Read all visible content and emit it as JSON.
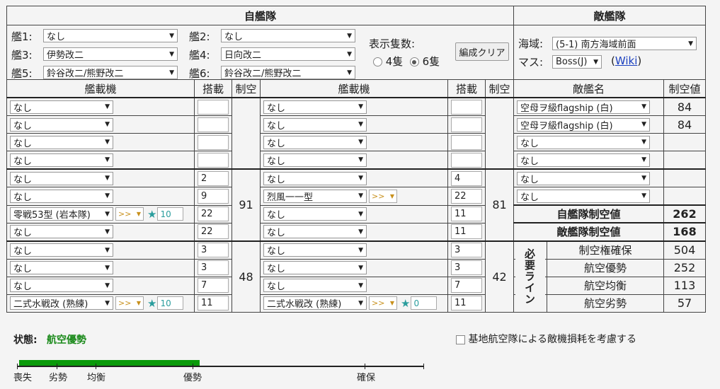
{
  "own_fleet": {
    "title": "自艦隊",
    "ships": [
      {
        "label": "艦1:",
        "value": "なし"
      },
      {
        "label": "艦2:",
        "value": "なし"
      },
      {
        "label": "艦3:",
        "value": "伊勢改二"
      },
      {
        "label": "艦4:",
        "value": "日向改二"
      },
      {
        "label": "艦5:",
        "value": "鈴谷改二/熊野改二"
      },
      {
        "label": "艦6:",
        "value": "鈴谷改二/熊野改二"
      }
    ],
    "display_count_label": "表示隻数:",
    "option_4": "4隻",
    "option_6": "6隻",
    "selected_option": "6隻",
    "clear_button": "編成クリア",
    "col_headers": {
      "aircraft": "艦載機",
      "slots": "搭載",
      "air_power": "制空"
    },
    "left": [
      {
        "aircraft": "なし",
        "slots": "",
        "extras": false
      },
      {
        "aircraft": "なし",
        "slots": "",
        "extras": false
      },
      {
        "aircraft": "なし",
        "slots": "",
        "extras": false
      },
      {
        "aircraft": "なし",
        "slots": "",
        "extras": false
      },
      {
        "aircraft": "なし",
        "slots": "2",
        "extras": false
      },
      {
        "aircraft": "なし",
        "slots": "9",
        "extras": false
      },
      {
        "aircraft": "零戦53型 (岩本隊)",
        "slots": "22",
        "extras": true,
        "proficiency": ">>",
        "improvement": "10"
      },
      {
        "aircraft": "なし",
        "slots": "22",
        "extras": false
      },
      {
        "aircraft": "なし",
        "slots": "3",
        "extras": false
      },
      {
        "aircraft": "なし",
        "slots": "3",
        "extras": false
      },
      {
        "aircraft": "なし",
        "slots": "7",
        "extras": false
      },
      {
        "aircraft": "二式水戦改 (熟練)",
        "slots": "11",
        "extras": true,
        "proficiency": ">>",
        "improvement": "10"
      }
    ],
    "left_air_power": [
      "",
      "",
      "48"
    ],
    "left_group2_air_power": "91",
    "right": [
      {
        "aircraft": "なし",
        "slots": "",
        "extras": false
      },
      {
        "aircraft": "なし",
        "slots": "",
        "extras": false
      },
      {
        "aircraft": "なし",
        "slots": "",
        "extras": false
      },
      {
        "aircraft": "なし",
        "slots": "",
        "extras": false
      },
      {
        "aircraft": "なし",
        "slots": "4",
        "extras": false
      },
      {
        "aircraft": "烈風一一型",
        "slots": "22",
        "extras": "prof",
        "proficiency": ">>"
      },
      {
        "aircraft": "なし",
        "slots": "11",
        "extras": false
      },
      {
        "aircraft": "なし",
        "slots": "11",
        "extras": false
      },
      {
        "aircraft": "なし",
        "slots": "3",
        "extras": false
      },
      {
        "aircraft": "なし",
        "slots": "3",
        "extras": false
      },
      {
        "aircraft": "なし",
        "slots": "7",
        "extras": false
      },
      {
        "aircraft": "二式水戦改 (熟練)",
        "slots": "11",
        "extras": true,
        "proficiency": ">>",
        "improvement": "0"
      }
    ],
    "right_group2_air_power": "81",
    "right_group3_air_power": "42"
  },
  "enemy_fleet": {
    "title": "敵艦隊",
    "area_label": "海域:",
    "area_value": "(5-1) 南方海域前面",
    "node_label": "マス:",
    "node_value": "Boss(J)",
    "wiki_open": "(",
    "wiki_link": "Wiki",
    "wiki_close": ")",
    "col_headers": {
      "name": "敵艦名",
      "air_power": "制空値"
    },
    "ships": [
      {
        "name": "空母ヲ級flagship (白)",
        "air_power": "84"
      },
      {
        "name": "空母ヲ級flagship (白)",
        "air_power": "84"
      },
      {
        "name": "なし",
        "air_power": ""
      },
      {
        "name": "なし",
        "air_power": ""
      },
      {
        "name": "なし",
        "air_power": ""
      }
    ],
    "own_total_label": "自艦隊制空値",
    "own_total": "262",
    "enemy_total_label": "敵艦隊制空値",
    "enemy_total": "168",
    "required_label": "必要ライン",
    "required": [
      {
        "label": "制空権確保",
        "value": "504"
      },
      {
        "label": "航空優勢",
        "value": "252"
      },
      {
        "label": "航空均衡",
        "value": "113"
      },
      {
        "label": "航空劣勢",
        "value": "57"
      }
    ]
  },
  "status": {
    "label": "状態:",
    "value": "航空優勢",
    "bar_fill_fraction": 0.444,
    "bar_color": "#0a9a0a",
    "scale_labels": [
      "喪失",
      "劣勢",
      "均衡",
      "優勢",
      "確保"
    ]
  },
  "base_air_checkbox": "基地航空隊による敵機損耗を考慮する"
}
